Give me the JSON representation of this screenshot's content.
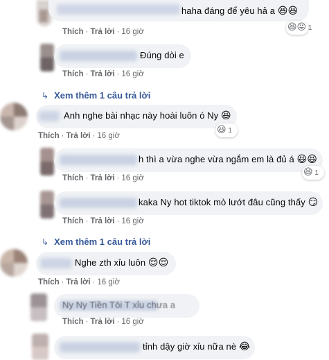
{
  "actions": {
    "like": "Thích",
    "reply": "Trả lời",
    "sep": "·"
  },
  "comments": [
    {
      "text": "haha đáng để yêu hả a",
      "emoji": "😆😆",
      "time": "16 giờ",
      "reaction": {
        "emoji": "😆😝",
        "count": "1"
      }
    },
    {
      "text": "Đúng dòi e",
      "emoji": "",
      "time": "16 giờ"
    },
    {
      "text": "Anh nghe bài nhạc này hoài luôn ó Ny",
      "emoji": "😆",
      "time": "16 giờ",
      "reaction": {
        "emoji": "😆",
        "count": "1"
      }
    },
    {
      "text": "h thì a vừa nghe vừa ngắm em là đủ á",
      "emoji": "😆😆",
      "time": "16 giờ",
      "reaction": {
        "emoji": "😆",
        "count": "1"
      }
    },
    {
      "text": "kaka Ny hot tiktok mò lướt đâu cũng thấy",
      "emoji": "😏",
      "time": "16 giờ"
    },
    {
      "text": "Nghe zth xỉu luôn",
      "emoji": "😌😌",
      "time": "16 giờ"
    },
    {
      "text": "Ny Ny Tiền Tôi T xỉu chưa a",
      "emoji": "",
      "time": "16 giờ"
    },
    {
      "text": "tỉnh dậy giờ xỉu nữa nè",
      "emoji": "😂",
      "time": ""
    }
  ],
  "view_more": [
    {
      "label": "Xem thêm 1 câu trả lời"
    },
    {
      "label": "Xem thêm 1 câu trả lời"
    }
  ],
  "colors": {
    "bubble": "#f0f2f5",
    "link": "#365899",
    "meta": "#65676b"
  }
}
